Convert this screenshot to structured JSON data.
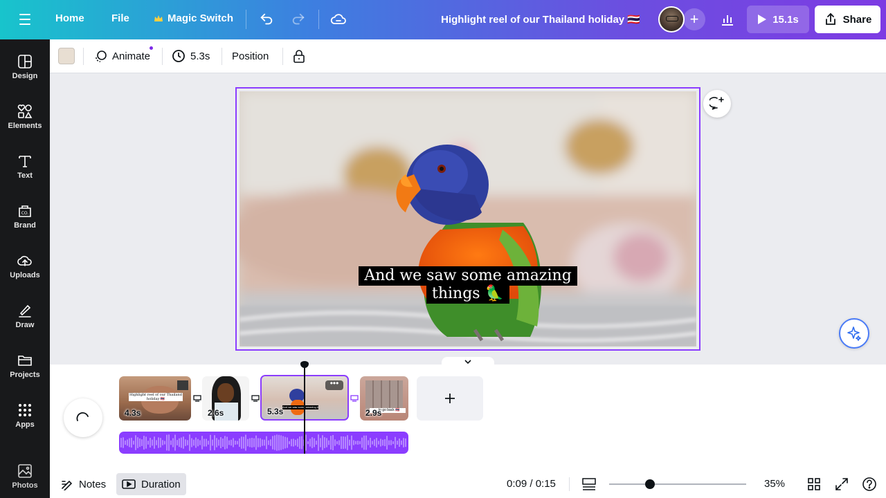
{
  "topbar": {
    "home": "Home",
    "file": "File",
    "magic_switch": "Magic Switch",
    "title": "Highlight reel of our Thailand holiday 🇹🇭",
    "play_duration": "15.1s",
    "share": "Share"
  },
  "sidenav": {
    "items": [
      {
        "label": "Design",
        "icon": "design-icon"
      },
      {
        "label": "Elements",
        "icon": "elements-icon"
      },
      {
        "label": "Text",
        "icon": "text-icon"
      },
      {
        "label": "Brand",
        "icon": "brand-icon"
      },
      {
        "label": "Uploads",
        "icon": "uploads-icon"
      },
      {
        "label": "Draw",
        "icon": "draw-icon"
      },
      {
        "label": "Projects",
        "icon": "projects-icon"
      },
      {
        "label": "Apps",
        "icon": "apps-icon"
      },
      {
        "label": "Photos",
        "icon": "photos-icon"
      }
    ]
  },
  "toolbar": {
    "animate": "Animate",
    "duration": "5.3s",
    "position": "Position",
    "swatch_color": "#e8ded2"
  },
  "canvas": {
    "caption_line1": "And we saw some amazing",
    "caption_line2": "things 🦜"
  },
  "timeline": {
    "clips": [
      {
        "duration": "4.3s",
        "text": "Highlight reel of our Thailand holiday 🇹🇭"
      },
      {
        "duration": "2.6s",
        "text": ""
      },
      {
        "duration": "5.3s",
        "text": "And we saw some amazing things"
      },
      {
        "duration": "2.9s",
        "text": "...to go back 🇹🇭"
      }
    ],
    "selected_clip": 2
  },
  "footer": {
    "notes": "Notes",
    "duration": "Duration",
    "time": "0:09 / 0:15",
    "zoom": "35%",
    "zoom_level": 0.3
  },
  "colors": {
    "accent": "#8b3dff",
    "sidebar_bg": "#18191b"
  }
}
